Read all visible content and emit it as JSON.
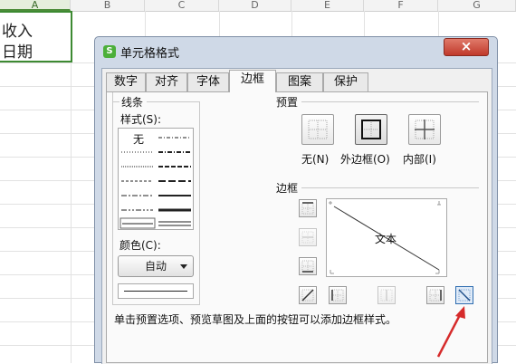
{
  "sheet": {
    "columns": [
      "A",
      "B",
      "C",
      "D",
      "E",
      "F",
      "G"
    ],
    "selected_cell_lines": [
      "收入",
      "日期"
    ]
  },
  "dialog": {
    "title": "单元格格式",
    "close_label": "×",
    "tabs": [
      "数字",
      "对齐",
      "字体",
      "边框",
      "图案",
      "保护"
    ],
    "active_tab": "边框",
    "lines_group": {
      "title": "线条",
      "style_label": "样式(S):",
      "none_label": "无",
      "color_label": "颜色(C):",
      "color_value": "自动"
    },
    "presets": {
      "title": "预置",
      "items": [
        "无(N)",
        "外边框(O)",
        "内部(I)"
      ]
    },
    "border": {
      "title": "边框",
      "preview_text": "文本"
    },
    "hint": "单击预置选项、预览草图及上面的按钮可以添加边框样式。"
  },
  "colors": {
    "accent_green": "#3d8a32",
    "selection_blue": "#2f6db0",
    "annotation_arrow": "#d62b2b"
  }
}
